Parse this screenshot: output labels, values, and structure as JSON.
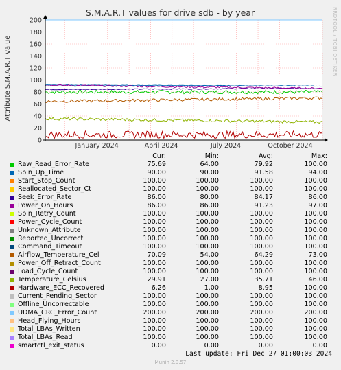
{
  "chart_data": {
    "type": "line",
    "title": "S.M.A.R.T values for drive sdb - by year",
    "ylabel": "Attribute S.M.A.R.T value",
    "xlabel": "",
    "ylim": [
      0,
      200
    ],
    "yticks": [
      "0",
      "20",
      "40",
      "60",
      "80",
      "100",
      "120",
      "140",
      "160",
      "180",
      "200"
    ],
    "xticks": [
      "January 2024",
      "April 2024",
      "July 2024",
      "October 2024"
    ],
    "columns": [
      "Cur:",
      "Min:",
      "Avg:",
      "Max:"
    ],
    "series": [
      {
        "name": "Raw_Read_Error_Rate",
        "color": "#00cc00",
        "cur": "75.69",
        "min": "64.00",
        "avg": "79.92",
        "max": "100.00"
      },
      {
        "name": "Spin_Up_Time",
        "color": "#0066b3",
        "cur": "90.00",
        "min": "90.00",
        "avg": "91.58",
        "max": "94.00"
      },
      {
        "name": "Start_Stop_Count",
        "color": "#ff8000",
        "cur": "100.00",
        "min": "100.00",
        "avg": "100.00",
        "max": "100.00"
      },
      {
        "name": "Reallocated_Sector_Ct",
        "color": "#ffcc00",
        "cur": "100.00",
        "min": "100.00",
        "avg": "100.00",
        "max": "100.00"
      },
      {
        "name": "Seek_Error_Rate",
        "color": "#330099",
        "cur": "86.00",
        "min": "80.00",
        "avg": "84.17",
        "max": "86.00"
      },
      {
        "name": "Power_On_Hours",
        "color": "#990099",
        "cur": "86.00",
        "min": "86.00",
        "avg": "91.23",
        "max": "97.00"
      },
      {
        "name": "Spin_Retry_Count",
        "color": "#ccff00",
        "cur": "100.00",
        "min": "100.00",
        "avg": "100.00",
        "max": "100.00"
      },
      {
        "name": "Power_Cycle_Count",
        "color": "#ff0000",
        "cur": "100.00",
        "min": "100.00",
        "avg": "100.00",
        "max": "100.00"
      },
      {
        "name": "Unknown_Attribute",
        "color": "#808080",
        "cur": "100.00",
        "min": "100.00",
        "avg": "100.00",
        "max": "100.00"
      },
      {
        "name": "Reported_Uncorrect",
        "color": "#008f00",
        "cur": "100.00",
        "min": "100.00",
        "avg": "100.00",
        "max": "100.00"
      },
      {
        "name": "Command_Timeout",
        "color": "#00487d",
        "cur": "100.00",
        "min": "100.00",
        "avg": "100.00",
        "max": "100.00"
      },
      {
        "name": "Airflow_Temperature_Cel",
        "color": "#b35a00",
        "cur": "70.09",
        "min": "54.00",
        "avg": "64.29",
        "max": "73.00"
      },
      {
        "name": "Power_Off_Retract_Count",
        "color": "#b38f00",
        "cur": "100.00",
        "min": "100.00",
        "avg": "100.00",
        "max": "100.00"
      },
      {
        "name": "Load_Cycle_Count",
        "color": "#6b006b",
        "cur": "100.00",
        "min": "100.00",
        "avg": "100.00",
        "max": "100.00"
      },
      {
        "name": "Temperature_Celsius",
        "color": "#8fb300",
        "cur": "29.91",
        "min": "27.00",
        "avg": "35.71",
        "max": "46.00"
      },
      {
        "name": "Hardware_ECC_Recovered",
        "color": "#b30000",
        "cur": "6.26",
        "min": "1.00",
        "avg": "8.95",
        "max": "100.00"
      },
      {
        "name": "Current_Pending_Sector",
        "color": "#bebebe",
        "cur": "100.00",
        "min": "100.00",
        "avg": "100.00",
        "max": "100.00"
      },
      {
        "name": "Offline_Uncorrectable",
        "color": "#80ff80",
        "cur": "100.00",
        "min": "100.00",
        "avg": "100.00",
        "max": "100.00"
      },
      {
        "name": "UDMA_CRC_Error_Count",
        "color": "#80c9ff",
        "cur": "200.00",
        "min": "200.00",
        "avg": "200.00",
        "max": "200.00"
      },
      {
        "name": "Head_Flying_Hours",
        "color": "#ffc080",
        "cur": "100.00",
        "min": "100.00",
        "avg": "100.00",
        "max": "100.00"
      },
      {
        "name": "Total_LBAs_Written",
        "color": "#ffe680",
        "cur": "100.00",
        "min": "100.00",
        "avg": "100.00",
        "max": "100.00"
      },
      {
        "name": "Total_LBAs_Read",
        "color": "#aa80ff",
        "cur": "100.00",
        "min": "100.00",
        "avg": "100.00",
        "max": "100.00"
      },
      {
        "name": "smartctl_exit_status",
        "color": "#ee00cc",
        "cur": "0.00",
        "min": "0.00",
        "avg": "0.00",
        "max": "0.00"
      }
    ]
  },
  "footer": {
    "last_update": "Last update: Fri Dec 27 01:00:03 2024",
    "generator": "Munin 2.0.57",
    "watermark": "RRDTOOL / TOBI OETIKER"
  }
}
